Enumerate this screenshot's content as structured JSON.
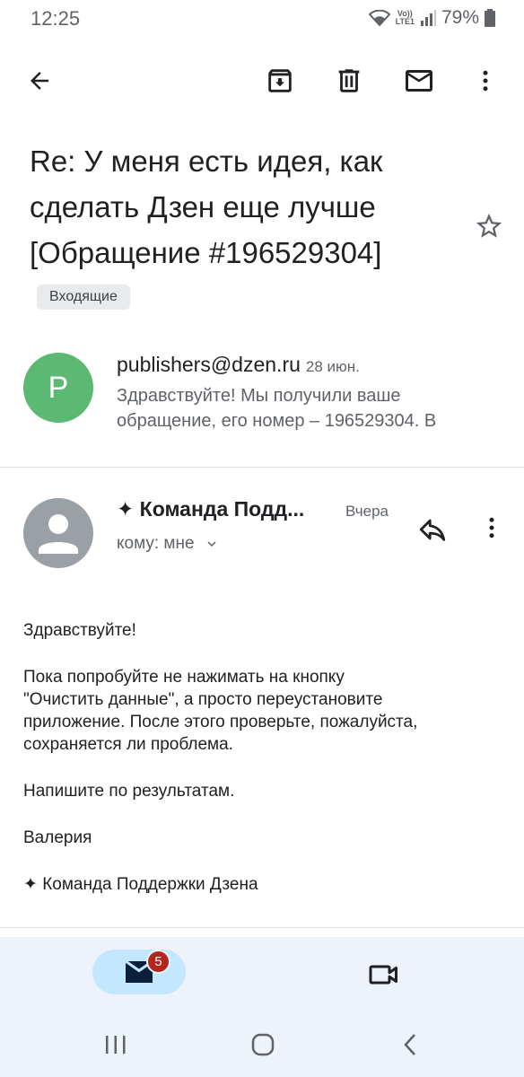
{
  "status_bar": {
    "time": "12:25",
    "network_label": "Vo)) LTE1",
    "battery": "79%"
  },
  "toolbar": {
    "back_icon": "arrow-left-icon",
    "archive_icon": "archive-icon",
    "delete_icon": "trash-icon",
    "mark_unread_icon": "mail-icon",
    "more_icon": "more-vert-icon"
  },
  "subject": {
    "text": "Re: У меня есть идея, как сделать Дзен еще лучше [Обращение #196529304]",
    "label": "Входящие",
    "star_icon": "star-outline-icon"
  },
  "thread": [
    {
      "avatar_letter": "P",
      "avatar_color": "#5bb974",
      "from": "publishers@dzen.ru",
      "date": "28 июн.",
      "snippet": "Здравствуйте! Мы получили ваше обращение, его номер – 196529304. В"
    },
    {
      "avatar_icon": "person-icon",
      "avatar_color": "#9aa0a6",
      "from": "✦ Команда Подд...",
      "date": "Вчера",
      "to": "кому: мне",
      "reply_icon": "reply-icon",
      "more_icon": "more-vert-icon"
    }
  ],
  "body": {
    "greeting": "Здравствуйте!",
    "para1": "Пока попробуйте не нажимать на кнопку\n\"Очистить данные\", а просто переустановите\nприложение. После этого проверьте, пожалуйста,\nсохраняется ли проблема.",
    "para2": "Напишите по результатам.",
    "name": "Валерия",
    "signature": "✦ Команда Поддержки Дзена"
  },
  "bottom_nav": {
    "mail_badge": "5",
    "mail_icon": "mail-filled-icon",
    "meet_icon": "video-camera-icon"
  },
  "colors": {
    "accent_active": "#c2e7ff",
    "badge": "#b3261e",
    "nav_bg": "#eef3fb"
  }
}
